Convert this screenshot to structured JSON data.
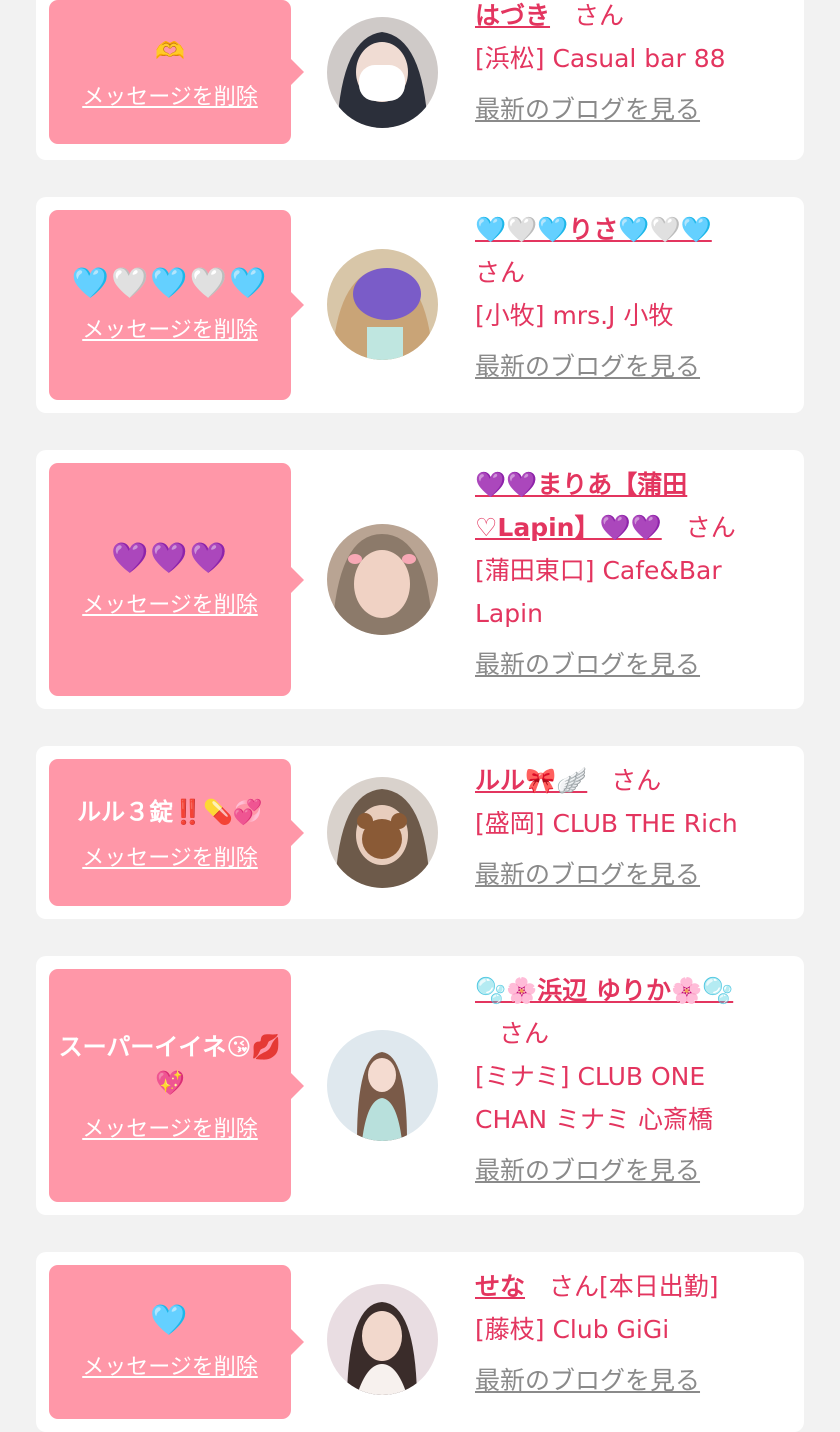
{
  "entries": [
    {
      "message": "🫶",
      "delete_label": "メッセージを削除",
      "name": "はづき",
      "honorific": "さん",
      "shop": "[浜松] Casual bar 88",
      "blog_link": "最新のブログを見る",
      "avatar_colors": [
        "#2b2f3a",
        "#d9d3d0"
      ]
    },
    {
      "message": "🩵🤍🩵🤍🩵",
      "delete_label": "メッセージを削除",
      "name": "🩵🤍🩵りさ🩵🤍🩵",
      "honorific": "さん",
      "shop": "[小牧] mrs.J 小牧",
      "blog_link": "最新のブログを見る",
      "avatar_colors": [
        "#7a5cc8",
        "#c9a477"
      ]
    },
    {
      "message": "💜💜💜",
      "delete_label": "メッセージを削除",
      "name": "💜💜まりあ【蒲田♡Lapin】💜💜",
      "honorific": "さん",
      "shop": "[蒲田東口] Cafe&Bar Lapin",
      "blog_link": "最新のブログを見る",
      "avatar_colors": [
        "#8c7a6a",
        "#e8c9b8"
      ]
    },
    {
      "message": "ルル３錠‼️💊💞",
      "delete_label": "メッセージを削除",
      "name": "ルル🎀🪽",
      "honorific": "さん",
      "shop": "[盛岡] CLUB THE Rich",
      "blog_link": "最新のブログを見る",
      "avatar_colors": [
        "#6d5a4a",
        "#c6a78a"
      ]
    },
    {
      "message": "スーパーイイネ😘💋💖",
      "delete_label": "メッセージを削除",
      "name": "🫧🌸浜辺 ゆりか🌸🫧",
      "honorific": "さん",
      "shop": "[ミナミ] CLUB ONE CHAN ミナミ 心斎橋",
      "blog_link": "最新のブログを見る",
      "avatar_colors": [
        "#dfe8ee",
        "#b8cbd6"
      ]
    },
    {
      "message": "🩵",
      "delete_label": "メッセージを削除",
      "name": "せな",
      "honorific": "さん[本日出勤]",
      "shop": "[藤枝] Club GiGi",
      "blog_link": "最新のブログを見る",
      "avatar_colors": [
        "#e9dde2",
        "#3a2c2a"
      ]
    }
  ]
}
